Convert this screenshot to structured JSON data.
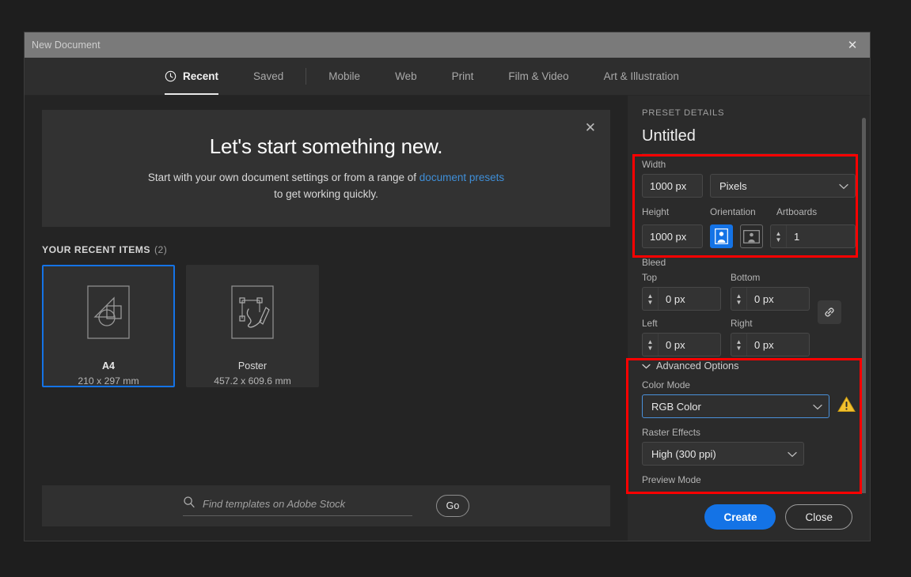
{
  "window": {
    "title": "New Document",
    "close_icon": "close-icon"
  },
  "tabs": [
    {
      "label": "Recent",
      "icon": "clock-icon",
      "active": true
    },
    {
      "label": "Saved",
      "active": false
    },
    {
      "label": "Mobile",
      "active": false
    },
    {
      "label": "Web",
      "active": false
    },
    {
      "label": "Print",
      "active": false
    },
    {
      "label": "Film & Video",
      "active": false
    },
    {
      "label": "Art & Illustration",
      "active": false
    }
  ],
  "banner": {
    "heading": "Let's start something new.",
    "body_before": "Start with your own document settings or from a range of ",
    "link": "document presets",
    "body_after": "to get working quickly.",
    "close_icon": "close-icon"
  },
  "recent": {
    "heading": "YOUR RECENT ITEMS",
    "count": "(2)",
    "items": [
      {
        "name": "A4",
        "dimensions": "210 x 297 mm",
        "selected": true,
        "thumb_icon": "shapes-document-icon"
      },
      {
        "name": "Poster",
        "dimensions": "457.2 x 609.6 mm",
        "selected": false,
        "thumb_icon": "pen-path-document-icon"
      }
    ]
  },
  "search": {
    "placeholder": "Find templates on Adobe Stock",
    "value": "",
    "icon": "search-icon",
    "go_label": "Go"
  },
  "preset": {
    "section_label": "PRESET DETAILS",
    "name": "Untitled",
    "width": {
      "label": "Width",
      "value": "1000 px"
    },
    "units": {
      "value": "Pixels",
      "icon": "chevron-down-icon"
    },
    "height": {
      "label": "Height",
      "value": "1000 px"
    },
    "orientation": {
      "label": "Orientation",
      "portrait_icon": "portrait-orientation-icon",
      "landscape_icon": "landscape-orientation-icon",
      "selected": "portrait"
    },
    "artboards": {
      "label": "Artboards",
      "value": "1"
    },
    "bleed": {
      "label": "Bleed",
      "top": {
        "label": "Top",
        "value": "0 px"
      },
      "bottom": {
        "label": "Bottom",
        "value": "0 px"
      },
      "left": {
        "label": "Left",
        "value": "0 px"
      },
      "right": {
        "label": "Right",
        "value": "0 px"
      },
      "link_icon": "link-chain-icon"
    },
    "advanced": {
      "toggle_label": "Advanced Options",
      "toggle_icon": "chevron-down-icon",
      "color_mode": {
        "label": "Color Mode",
        "value": "RGB Color",
        "warning_icon": "warning-triangle-icon"
      },
      "raster_effects": {
        "label": "Raster Effects",
        "value": "High (300 ppi)"
      },
      "preview_mode": {
        "label": "Preview Mode"
      }
    }
  },
  "footer": {
    "create_label": "Create",
    "close_label": "Close"
  },
  "colors": {
    "accent_blue": "#1473e6",
    "link_blue": "#3f8fd8",
    "warning_amber": "#f2c12e",
    "annotation_red": "#ff0000"
  }
}
